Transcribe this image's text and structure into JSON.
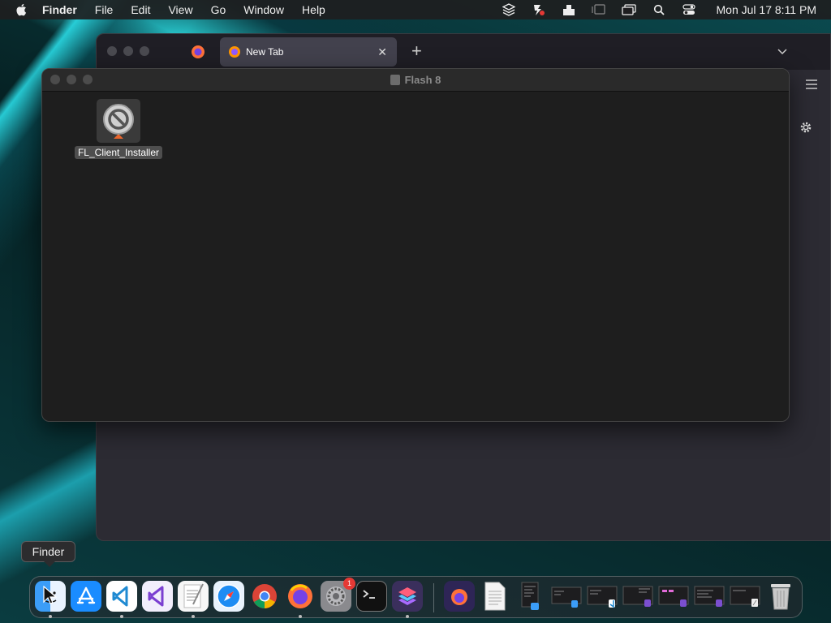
{
  "menubar": {
    "app_name": "Finder",
    "items": [
      "File",
      "Edit",
      "View",
      "Go",
      "Window",
      "Help"
    ],
    "clock": "Mon Jul 17  8:11 PM",
    "status_icons": [
      "layers-icon",
      "vpn-icon",
      "bag-icon",
      "airplay-icon",
      "display-icon",
      "search-icon",
      "control-center-icon"
    ]
  },
  "browser": {
    "active_tab_title": "New Tab",
    "new_tab_symbol": "+",
    "close_symbol": "✕"
  },
  "finder": {
    "window_title": "Flash 8",
    "files": [
      {
        "name": "FL_Client_Installer",
        "icon": "installer-icon"
      }
    ]
  },
  "tooltip": {
    "text": "Finder"
  },
  "dock": {
    "apps": [
      {
        "name": "finder",
        "icon": "finder-icon",
        "running": true
      },
      {
        "name": "app-store",
        "icon": "app-store-icon",
        "running": false
      },
      {
        "name": "vscode",
        "icon": "vscode-icon",
        "running": true
      },
      {
        "name": "visual-studio",
        "icon": "visual-studio-icon",
        "running": false
      },
      {
        "name": "textedit",
        "icon": "textedit-icon",
        "running": true
      },
      {
        "name": "safari",
        "icon": "safari-icon",
        "running": false
      },
      {
        "name": "chrome",
        "icon": "chrome-icon",
        "running": false
      },
      {
        "name": "firefox",
        "icon": "firefox-icon",
        "running": true
      },
      {
        "name": "system-settings",
        "icon": "settings-icon",
        "running": false,
        "badge": "1"
      },
      {
        "name": "terminal",
        "icon": "terminal-icon",
        "running": false
      },
      {
        "name": "shortcuts",
        "icon": "shortcuts-icon",
        "running": true
      }
    ],
    "recent": [
      "firefox-doc-icon",
      "text-doc-icon",
      "window-thumb-icon",
      "window-thumb-icon",
      "window-thumb-icon",
      "window-thumb-icon",
      "window-thumb-icon",
      "window-thumb-icon",
      "window-thumb-icon"
    ],
    "trash": "trash-icon"
  }
}
